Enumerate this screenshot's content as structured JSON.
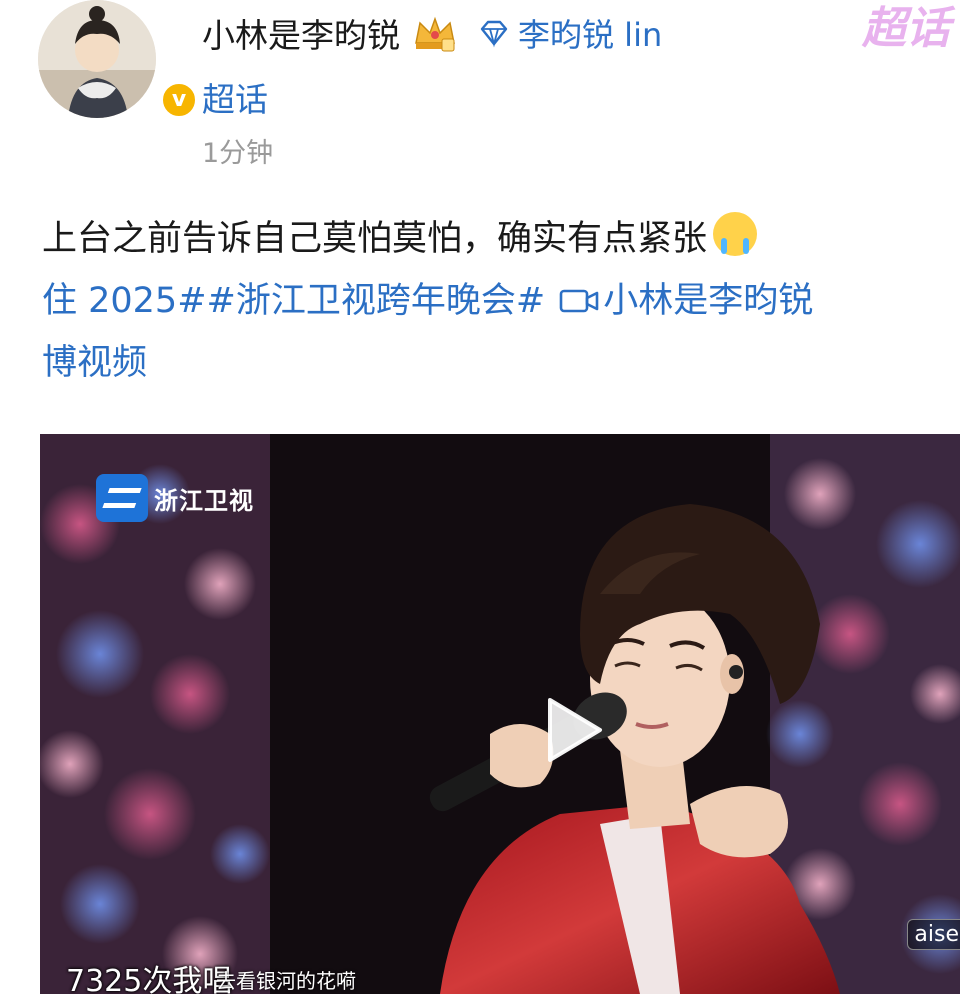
{
  "header": {
    "username": "小林是李昀锐",
    "fan_club_label": "李昀锐 lin",
    "supertopic_label": "超话",
    "timestamp": "1分钟",
    "corner_tag": "超话",
    "verified_badge": "v"
  },
  "post": {
    "line1_text": "上台之前告诉自己莫怕莫怕，确实有点紧张",
    "line2_link1": "住 2025##浙江卫视跨年晚会#",
    "line2_link2": "小林是李昀锐",
    "line3_link": "博视频",
    "emoji": "crying-face-icon"
  },
  "video": {
    "channel_logo_text": "浙江卫视",
    "watermark": "aise",
    "subtitle_main": "7325次我唱",
    "subtitle_small": "去看银河的花嗬"
  },
  "colors": {
    "link": "#2b6fc4",
    "timestamp": "#9a9a9a",
    "badge": "#f7b500",
    "corner_tag": "#e8b2ee"
  }
}
